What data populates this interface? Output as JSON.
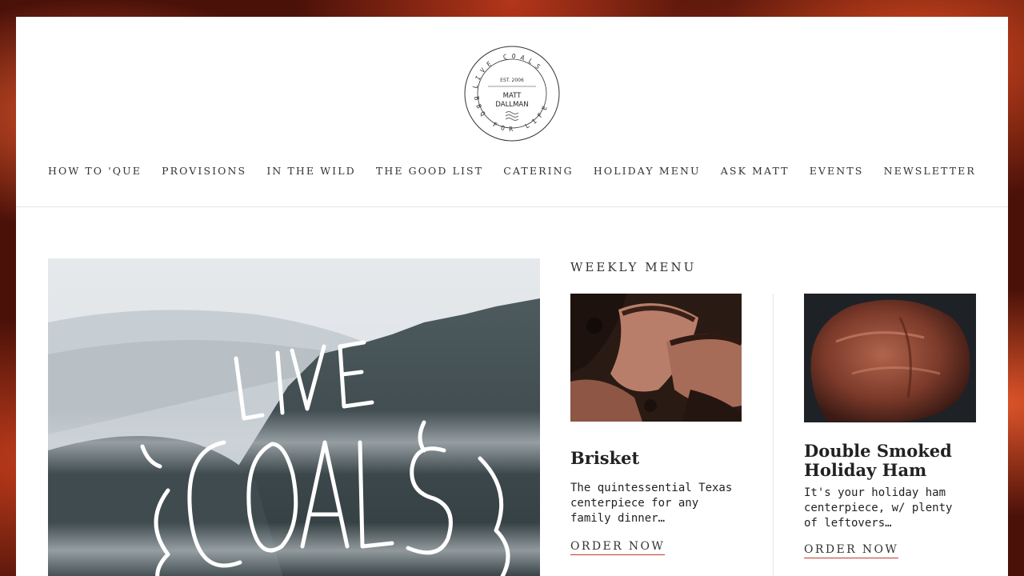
{
  "logo": {
    "ring_top": "LIVE COALS",
    "ring_bottom": "BBQ FOR LIFE",
    "est": "EST. 2006",
    "name_line1": "MATT",
    "name_line2": "DALLMAN"
  },
  "nav": {
    "items": [
      "HOW TO 'QUE",
      "PROVISIONS",
      "IN THE WILD",
      "THE GOOD LIST",
      "CATERING",
      "HOLIDAY MENU",
      "ASK MATT",
      "EVENTS",
      "NEWSLETTER"
    ]
  },
  "hero": {
    "art_text": "LIVE COALS"
  },
  "weekly": {
    "title": "WEEKLY MENU",
    "cards": [
      {
        "title": "Brisket",
        "description": "The quintessential Texas centerpiece for any family dinner…",
        "cta": "ORDER NOW"
      },
      {
        "title": "Double Smoked Holiday Ham",
        "description": "It's your holiday ham centerpiece, w/ plenty of leftovers…",
        "cta": "ORDER NOW"
      }
    ]
  }
}
